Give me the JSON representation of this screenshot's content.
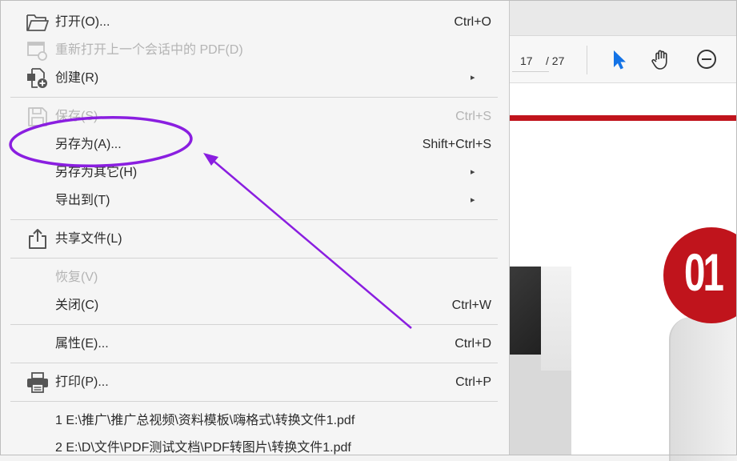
{
  "colors": {
    "annotation": "#8a1ee0",
    "accent_blue": "#1473e6",
    "brand_red": "#c0141c"
  },
  "menu": {
    "items": [
      {
        "label": "打开(O)...",
        "shortcut": "Ctrl+O",
        "icon": "folder-open-icon"
      },
      {
        "label": "重新打开上一个会话中的 PDF(D)",
        "shortcut": "",
        "icon": "reopen-session-icon",
        "disabled": true
      },
      {
        "label": "创建(R)",
        "shortcut": "",
        "icon": "create-pdf-icon",
        "submenu": true
      },
      {
        "label": "保存(S)",
        "shortcut": "Ctrl+S",
        "icon": "save-icon",
        "disabled": true
      },
      {
        "label": "另存为(A)...",
        "shortcut": "Shift+Ctrl+S"
      },
      {
        "label": "另存为其它(H)",
        "shortcut": "",
        "submenu": true
      },
      {
        "label": "导出到(T)",
        "shortcut": "",
        "submenu": true
      },
      {
        "label": "共享文件(L)",
        "shortcut": "",
        "icon": "share-icon"
      },
      {
        "label": "恢复(V)",
        "shortcut": "",
        "disabled": true
      },
      {
        "label": "关闭(C)",
        "shortcut": "Ctrl+W"
      },
      {
        "label": "属性(E)...",
        "shortcut": "Ctrl+D"
      },
      {
        "label": "打印(P)...",
        "shortcut": "Ctrl+P",
        "icon": "print-icon"
      }
    ],
    "submenu_arrow": "▸",
    "recent_files": [
      "1 E:\\推广\\推广总视频\\资料模板\\嗨格式\\转换文件1.pdf",
      "2 E:\\D\\文件\\PDF测试文档\\PDF转图片\\转换文件1.pdf"
    ]
  },
  "toolbar": {
    "page_current": "17",
    "page_total": "/ 27",
    "tools": [
      "select-cursor-icon",
      "hand-tool-icon",
      "zoom-out-icon"
    ]
  },
  "document": {
    "badge_text": "01"
  }
}
